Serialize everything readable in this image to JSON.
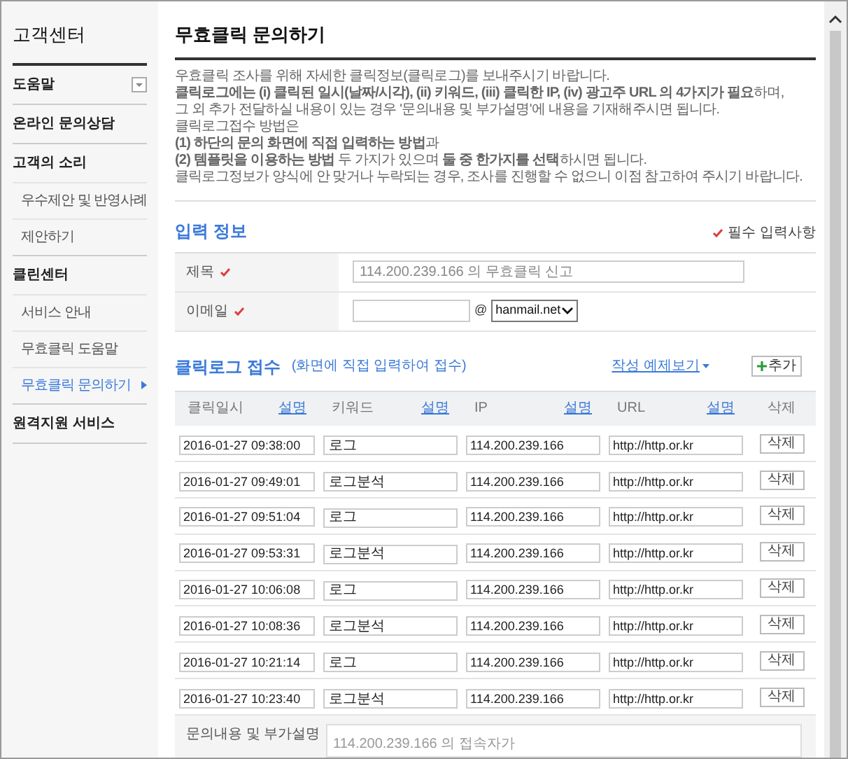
{
  "sidebar": {
    "title": "고객센터",
    "groups": [
      {
        "label": "도움말",
        "has_toggle": true
      },
      {
        "label": "온라인 문의상담",
        "has_toggle": false
      },
      {
        "label": "고객의 소리",
        "has_toggle": false,
        "children": [
          {
            "label": "우수제안 및 반영사례",
            "selected": false
          },
          {
            "label": "제안하기",
            "selected": false
          }
        ]
      },
      {
        "label": "클린센터",
        "has_toggle": false,
        "children": [
          {
            "label": "서비스 안내",
            "selected": false
          },
          {
            "label": "무효클릭 도움말",
            "selected": false
          },
          {
            "label": "무효클릭 문의하기",
            "selected": true
          }
        ]
      },
      {
        "label": "원격지원 서비스",
        "has_toggle": false
      }
    ]
  },
  "page": {
    "title": "무효클릭 문의하기",
    "intro": [
      "우효클릭 조사를 위해 자세한 클릭정보(클릭로그)를 보내주시기 바랍니다.",
      "**클릭로그에는 (i) 클릭된 일시(날짜/시각), (ii) 키워드, (iii) 클릭한 IP, (iv) 광고주 URL 의 4가지가 필요**하며,",
      "그 외 추가 전달하실 내용이 있는 경우 '문의내용 및 부가설명'에 내용을 기재해주시면 됩니다.",
      "클릭로그접수 방법은",
      "**(1) 하단의 문의 화면에 직접 입력하는 방법**과",
      "**(2) 템플릿을 이용하는 방법** 두 가지가 있으며 **둘 중 한가지를 선택**하시면 됩니다.",
      "클릭로그정보가 양식에 안 맞거나 누락되는 경우, 조사를 진행할 수 없으니 이점 참고하여 주시기 바랍니다."
    ]
  },
  "input_info": {
    "title": "입력 정보",
    "required_note": "필수 입력사항",
    "fields": [
      {
        "kind": "text",
        "label": "제목",
        "required": true,
        "placeholder": "114.200.239.166 의 무효클릭 신고"
      },
      {
        "kind": "email",
        "label": "이메일",
        "required": true,
        "at": "@",
        "domain": "hanmail.net"
      }
    ]
  },
  "click_log": {
    "title": "클릭로그 접수",
    "subtitle": "(화면에 직접 입력하여 접수)",
    "example_link": "작성 예제보기",
    "add_button": "추가",
    "columns": [
      {
        "label": "클릭일시",
        "help": "설명"
      },
      {
        "label": "키워드",
        "help": "설명"
      },
      {
        "label": "IP",
        "help": "설명"
      },
      {
        "label": "URL",
        "help": "설명"
      },
      {
        "label": "삭제"
      }
    ],
    "rows": [
      {
        "date": "2016-01-27 09:38:00",
        "keyword": "로그",
        "ip": "114.200.239.166",
        "url": "http://http.or.kr",
        "action": "삭제"
      },
      {
        "date": "2016-01-27 09:49:01",
        "keyword": "로그분석",
        "ip": "114.200.239.166",
        "url": "http://http.or.kr",
        "action": "삭제"
      },
      {
        "date": "2016-01-27 09:51:04",
        "keyword": "로그",
        "ip": "114.200.239.166",
        "url": "http://http.or.kr",
        "action": "삭제"
      },
      {
        "date": "2016-01-27 09:53:31",
        "keyword": "로그분석",
        "ip": "114.200.239.166",
        "url": "http://http.or.kr",
        "action": "삭제"
      },
      {
        "date": "2016-01-27 10:06:08",
        "keyword": "로그",
        "ip": "114.200.239.166",
        "url": "http://http.or.kr",
        "action": "삭제"
      },
      {
        "date": "2016-01-27 10:08:36",
        "keyword": "로그분석",
        "ip": "114.200.239.166",
        "url": "http://http.or.kr",
        "action": "삭제"
      },
      {
        "date": "2016-01-27 10:21:14",
        "keyword": "로그",
        "ip": "114.200.239.166",
        "url": "http://http.or.kr",
        "action": "삭제"
      },
      {
        "date": "2016-01-27 10:23:40",
        "keyword": "로그분석",
        "ip": "114.200.239.166",
        "url": "http://http.or.kr",
        "action": "삭제"
      }
    ],
    "inquiry": {
      "label": "문의내용 및 부가설명",
      "placeholder": "114.200.239.166 의 접속자가"
    }
  }
}
